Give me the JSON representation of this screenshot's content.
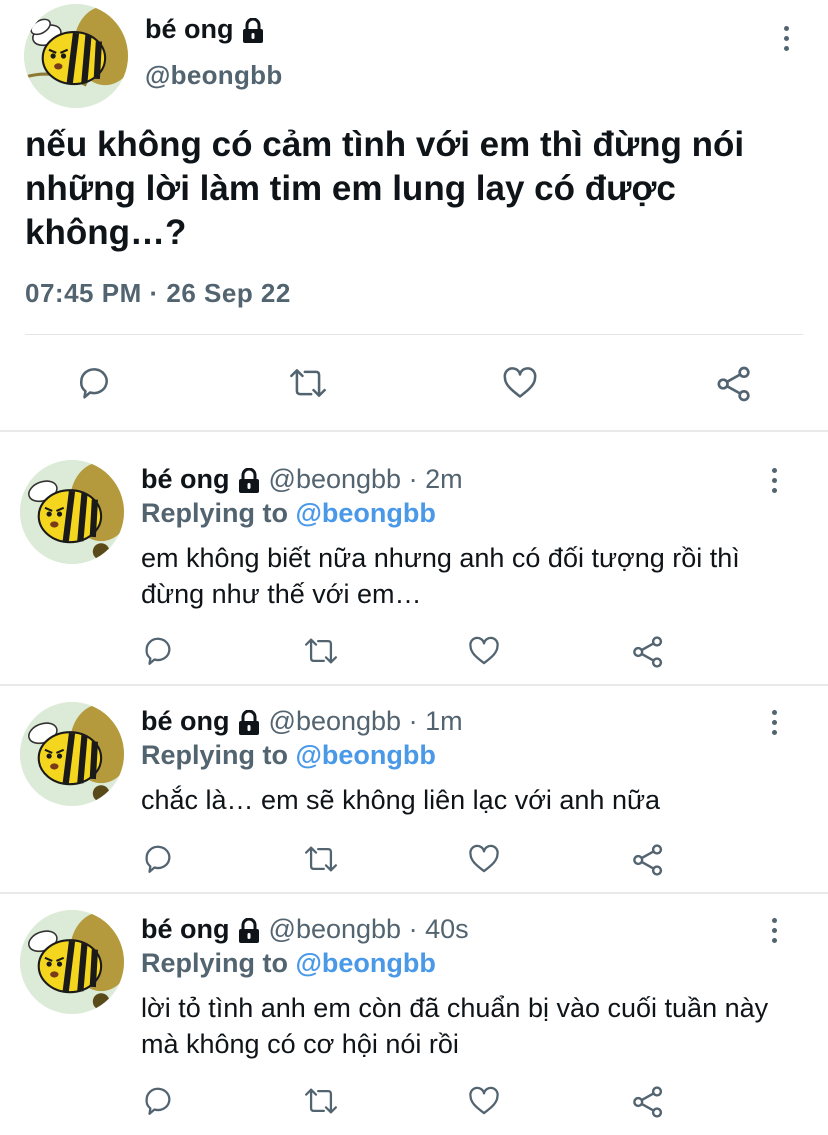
{
  "main_tweet": {
    "display_name": "bé ong",
    "handle": "@beongbb",
    "text": "nếu không có cảm tình với em thì đừng nói những lời làm tim em lung lay có được không…?",
    "time": "07:45 PM",
    "separator": "·",
    "date": "26 Sep 22"
  },
  "replies": [
    {
      "display_name": "bé ong",
      "handle": "@beongbb",
      "age": "2m",
      "replying_label": "Replying to",
      "replying_to": "@beongbb",
      "text": "em không biết nữa nhưng anh có đối tượng rồi thì đừng như thế với em…"
    },
    {
      "display_name": "bé ong",
      "handle": "@beongbb",
      "age": "1m",
      "replying_label": "Replying to",
      "replying_to": "@beongbb",
      "text": "chắc là… em sẽ không liên lạc với anh nữa"
    },
    {
      "display_name": "bé ong",
      "handle": "@beongbb",
      "age": "40s",
      "replying_label": "Replying to",
      "replying_to": "@beongbb",
      "text": "lời tỏ tình anh em còn đã chuẩn bị vào cuối tuần này mà không có cơ hội nói rồi"
    }
  ],
  "icons": {
    "reply": "reply-icon",
    "retweet": "retweet-icon",
    "like": "heart-icon",
    "share": "share-icon",
    "more": "more-icon",
    "lock": "lock-icon"
  },
  "colors": {
    "text": "#0f1419",
    "secondary": "#536471",
    "mention": "#4a99e9",
    "divider": "#e7e9ea"
  }
}
